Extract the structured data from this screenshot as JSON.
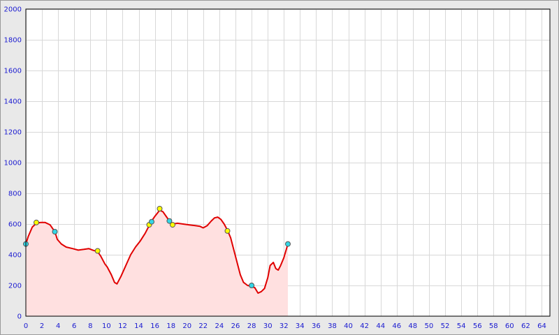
{
  "chart_data": {
    "type": "area",
    "title": "",
    "xlabel": "",
    "ylabel": "",
    "xlim": [
      0,
      65
    ],
    "ylim": [
      0,
      2000
    ],
    "x_ticks": [
      0,
      2,
      4,
      6,
      8,
      10,
      12,
      14,
      16,
      18,
      20,
      22,
      24,
      26,
      28,
      30,
      32,
      34,
      36,
      38,
      40,
      42,
      44,
      46,
      48,
      50,
      52,
      54,
      56,
      58,
      60,
      62,
      64
    ],
    "y_ticks": [
      0,
      200,
      400,
      600,
      800,
      1000,
      1200,
      1400,
      1600,
      1800,
      2000
    ],
    "grid": true,
    "legend": "none",
    "colors": {
      "line": "#e00000",
      "fill": "#ffe0e0",
      "grid": "#d8d8d8",
      "plot_bg": "#ffffff",
      "tick_text": "#1a1ad0",
      "marker_yellow": "#ffff00",
      "marker_cyan": "#33d6e6"
    },
    "series": [
      {
        "x": [
          0,
          0.3,
          0.8,
          1.3,
          1.8,
          2.4,
          3.0,
          3.6,
          3.9,
          4.4,
          5.0,
          5.8,
          6.5,
          7.2,
          7.8,
          8.3,
          8.9,
          9.3,
          9.8,
          10.1,
          10.6,
          11.0,
          11.3,
          11.8,
          12.4,
          13.0,
          13.6,
          14.2,
          14.8,
          15.3,
          15.6,
          16.0,
          16.6,
          17.0,
          17.4,
          17.8,
          18.2,
          18.8,
          19.5,
          20.2,
          21.0,
          21.6,
          22.0,
          22.5,
          23.0,
          23.4,
          23.8,
          24.2,
          24.6,
          25.0,
          25.4,
          25.8,
          26.2,
          26.6,
          27.0,
          27.5,
          28.0,
          28.4,
          28.8,
          29.2,
          29.6,
          30.0,
          30.3,
          30.7,
          31.0,
          31.3,
          31.6,
          32.0,
          32.5
        ],
        "y": [
          470,
          520,
          580,
          605,
          610,
          610,
          595,
          550,
          500,
          470,
          450,
          440,
          430,
          435,
          440,
          430,
          420,
          390,
          340,
          320,
          270,
          220,
          210,
          260,
          330,
          400,
          450,
          490,
          540,
          590,
          620,
          650,
          690,
          680,
          650,
          620,
          600,
          605,
          600,
          595,
          590,
          585,
          575,
          590,
          620,
          640,
          645,
          630,
          600,
          560,
          510,
          430,
          350,
          270,
          220,
          200,
          195,
          185,
          150,
          160,
          180,
          250,
          330,
          350,
          310,
          300,
          330,
          380,
          470
        ]
      }
    ],
    "markers": [
      {
        "x": 0,
        "y": 470,
        "color": "cyan"
      },
      {
        "x": 1.3,
        "y": 610,
        "color": "yellow"
      },
      {
        "x": 3.6,
        "y": 550,
        "color": "cyan"
      },
      {
        "x": 8.9,
        "y": 425,
        "color": "yellow"
      },
      {
        "x": 15.3,
        "y": 595,
        "color": "yellow"
      },
      {
        "x": 15.6,
        "y": 615,
        "color": "cyan"
      },
      {
        "x": 16.6,
        "y": 700,
        "color": "yellow"
      },
      {
        "x": 17.8,
        "y": 620,
        "color": "cyan"
      },
      {
        "x": 18.2,
        "y": 595,
        "color": "yellow"
      },
      {
        "x": 25.0,
        "y": 555,
        "color": "yellow"
      },
      {
        "x": 28.0,
        "y": 200,
        "color": "cyan"
      },
      {
        "x": 32.5,
        "y": 470,
        "color": "cyan"
      }
    ]
  }
}
